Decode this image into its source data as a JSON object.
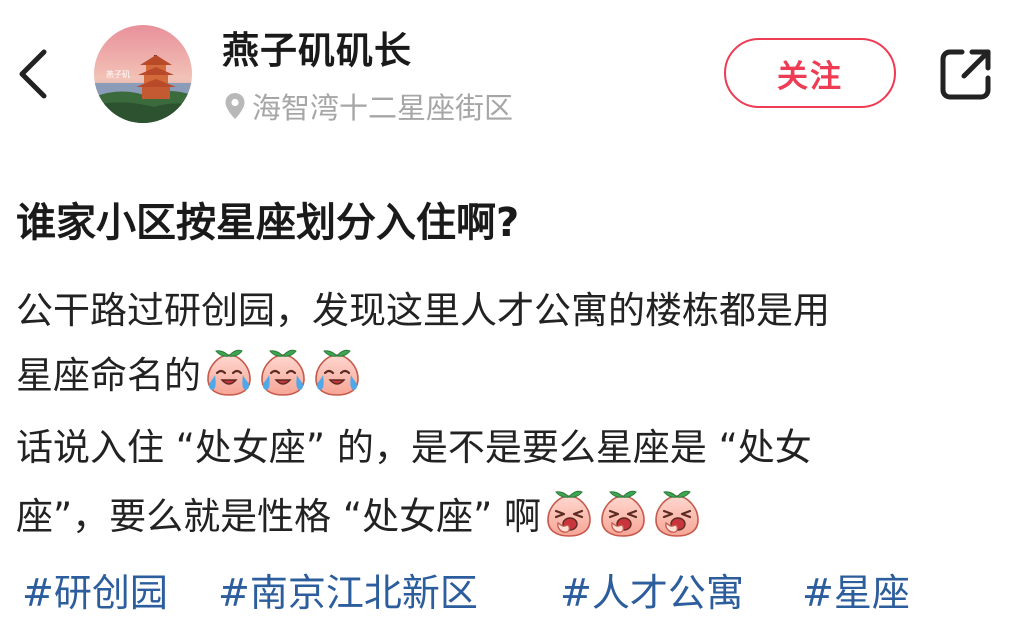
{
  "header": {
    "back_icon": "chevron-left-icon",
    "user_name": "燕子矶矶长",
    "location_icon": "location-pin-icon",
    "location": "海智湾十二星座街区",
    "follow_label": "关注",
    "share_icon": "share-external-icon",
    "avatar_text": "燕子矶"
  },
  "post": {
    "title": "谁家小区按星座划分入住啊?",
    "lines": [
      "公干路过研创园，发现这里人才公寓的楼栋都是用",
      "星座命名的",
      "话说入住 “处女座” 的，是不是要么星座是 “处女",
      "座”，要么就是性格 “处女座” 啊"
    ],
    "emoji_crying": "crying-peach-emoji",
    "emoji_laughing": "laughing-peach-emoji"
  },
  "tags": [
    "#研创园",
    "#南京江北新区",
    "#人才公寓",
    "#星座"
  ],
  "colors": {
    "accent": "#ee3c54",
    "tag": "#2c5d9c",
    "muted": "#a6a6a6"
  }
}
